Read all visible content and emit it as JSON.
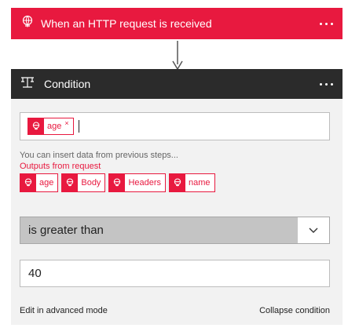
{
  "trigger": {
    "title": "When an HTTP request is received",
    "icon": "http-request-icon",
    "color": "#e8193f"
  },
  "condition": {
    "title": "Condition",
    "icon": "condition-icon",
    "header_color": "#2b2b2b",
    "left_operand_token": "age",
    "token_remove_glyph": "×",
    "hint": "You can insert data from previous steps...",
    "outputs_title": "Outputs from request",
    "outputs": [
      "age",
      "Body",
      "Headers",
      "name"
    ],
    "operator": "is greater than",
    "right_value": "40",
    "advanced_mode_label": "Edit in advanced mode",
    "collapse_label": "Collapse condition"
  }
}
